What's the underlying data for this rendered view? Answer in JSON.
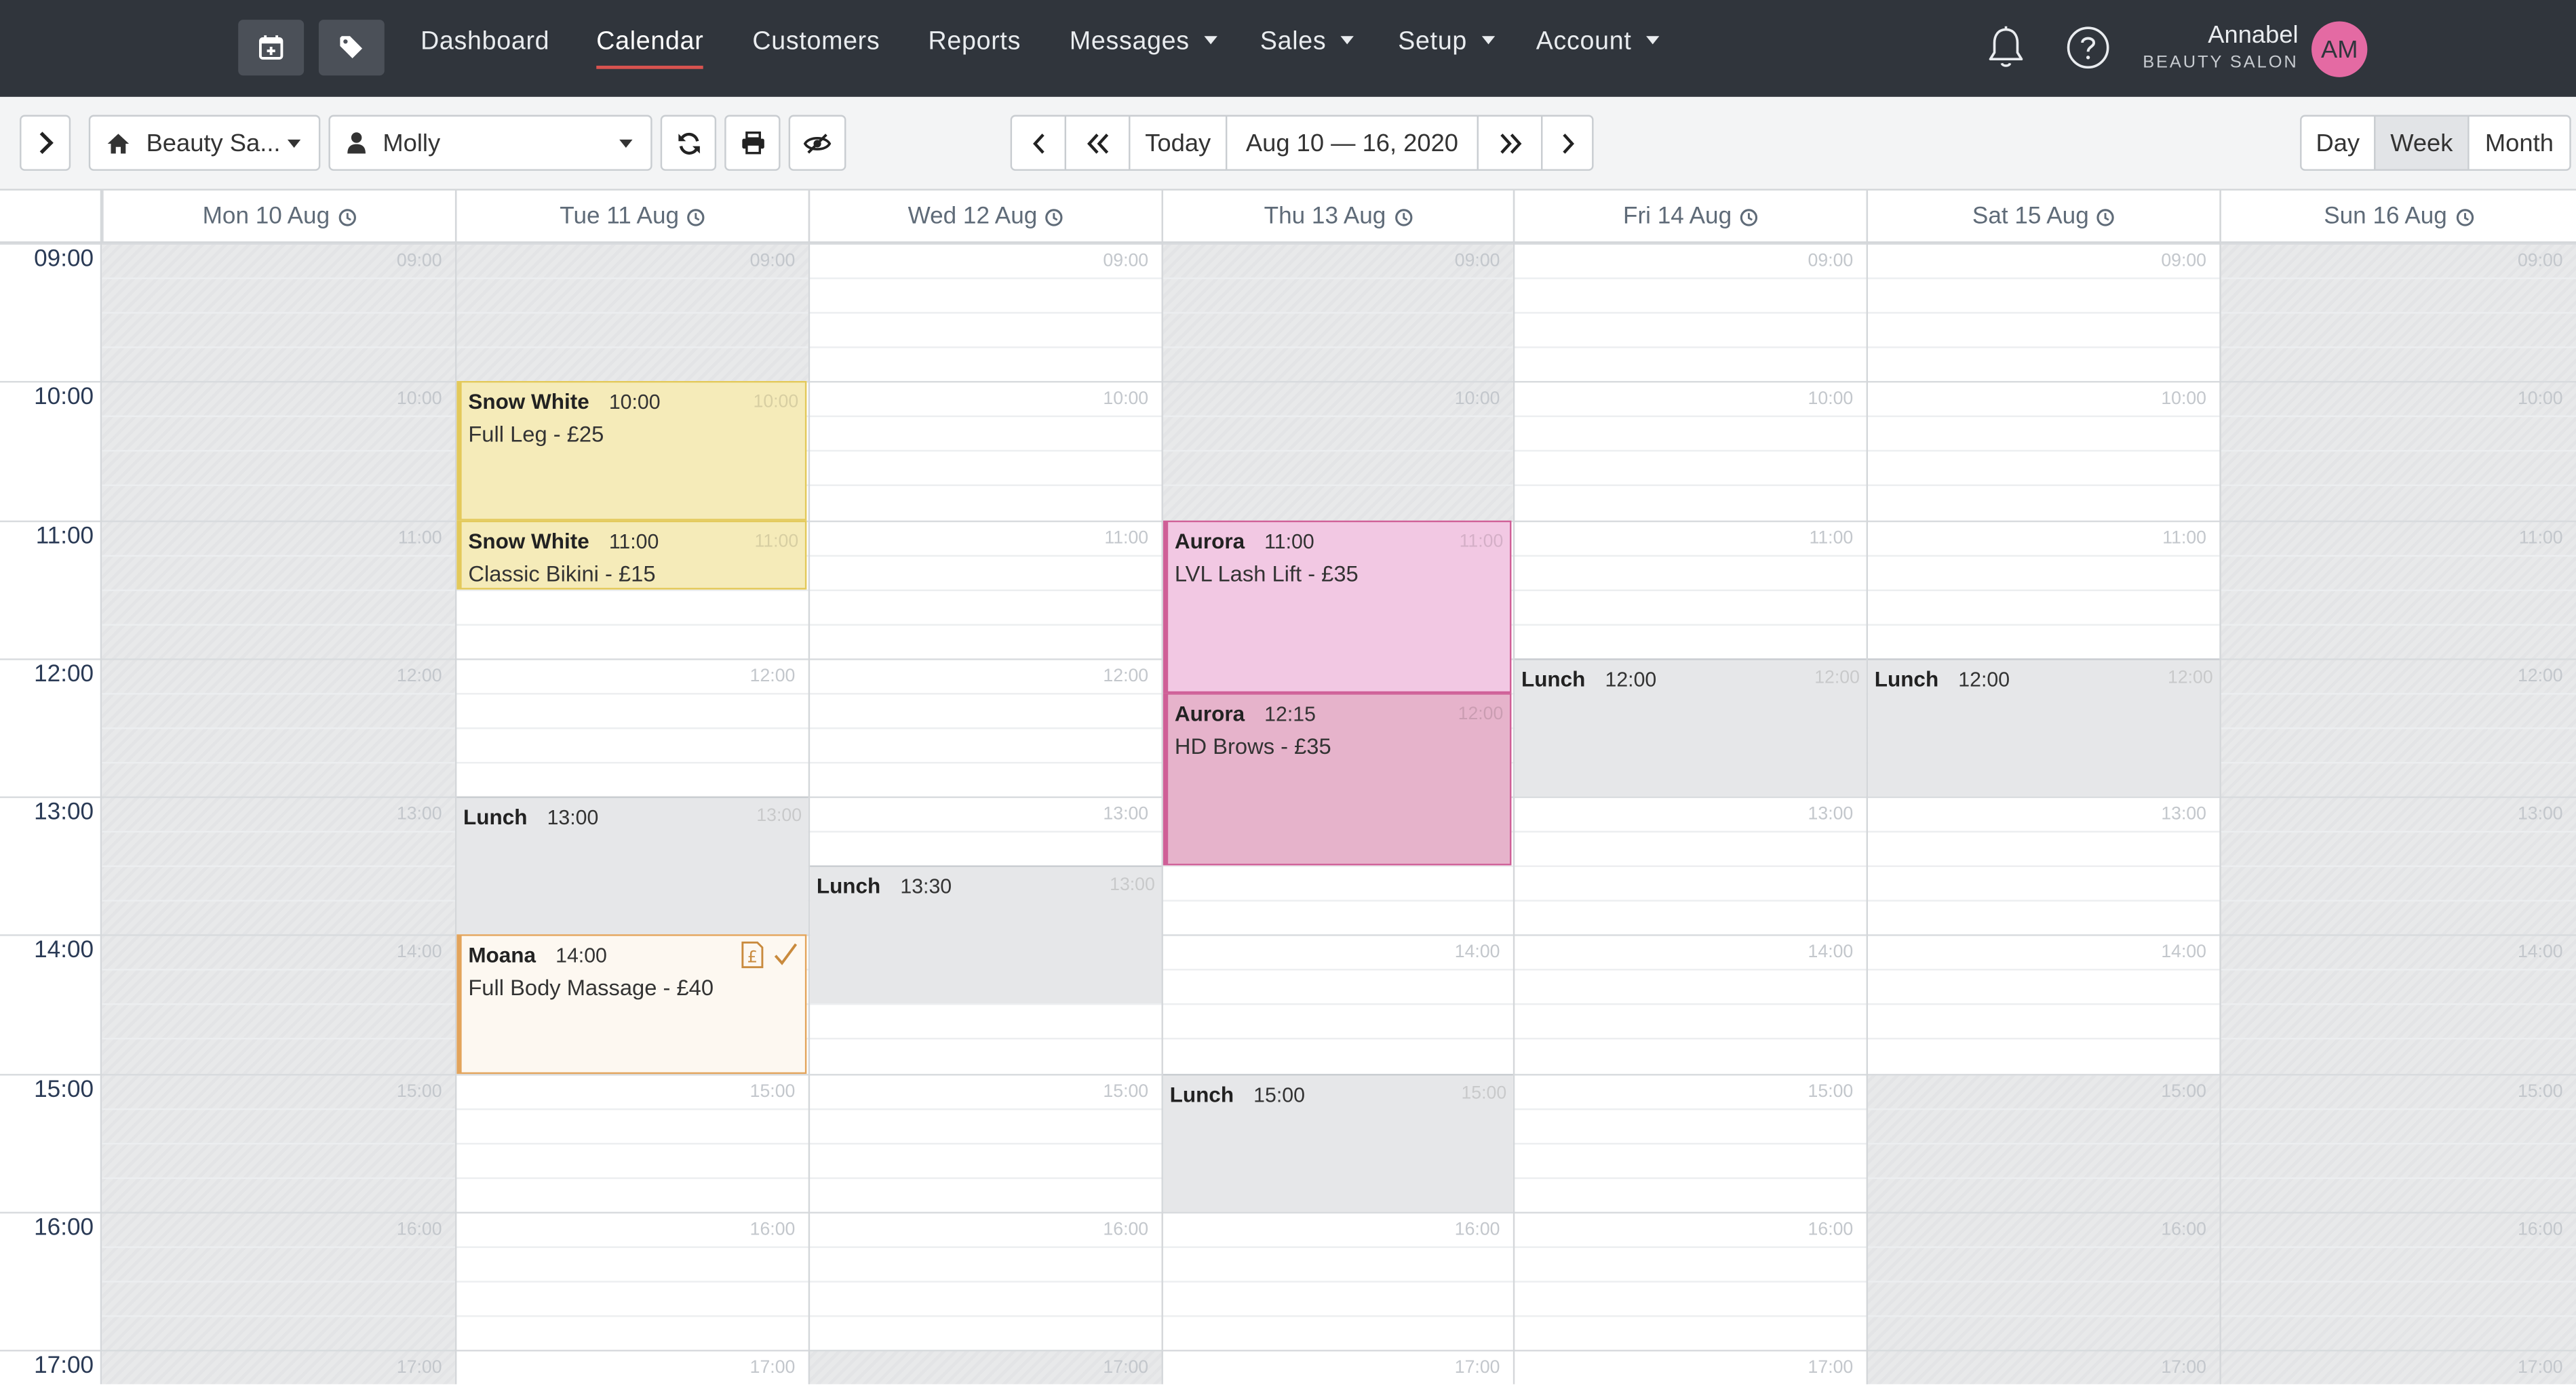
{
  "nav": {
    "items": [
      {
        "label": "Dashboard",
        "active": false,
        "has_menu": false
      },
      {
        "label": "Calendar",
        "active": true,
        "has_menu": false
      },
      {
        "label": "Customers",
        "active": false,
        "has_menu": false
      },
      {
        "label": "Reports",
        "active": false,
        "has_menu": false
      },
      {
        "label": "Messages",
        "active": false,
        "has_menu": true
      },
      {
        "label": "Sales",
        "active": false,
        "has_menu": true
      },
      {
        "label": "Setup",
        "active": false,
        "has_menu": true
      },
      {
        "label": "Account",
        "active": false,
        "has_menu": true
      }
    ],
    "user_name": "Annabel",
    "user_business": "BEAUTY SALON",
    "avatar_initials": "AM",
    "icons": [
      "calendar-plus-icon",
      "tag-icon",
      "bell-icon",
      "help-icon"
    ]
  },
  "toolbar": {
    "location_select": "Beauty Sa...",
    "staff_select": "Molly",
    "today_label": "Today",
    "date_range": "Aug 10 — 16, 2020",
    "views": [
      "Day",
      "Week",
      "Month"
    ],
    "active_view": "Week"
  },
  "calendar": {
    "days": [
      "Mon 10 Aug",
      "Tue 11 Aug",
      "Wed 12 Aug",
      "Thu 13 Aug",
      "Fri 14 Aug",
      "Sat 15 Aug",
      "Sun 16 Aug"
    ],
    "hours": [
      "09:00",
      "10:00",
      "11:00",
      "12:00",
      "13:00",
      "14:00",
      "15:00",
      "16:00",
      "17:00"
    ],
    "lunch_label": "Lunch",
    "lunches": [
      {
        "day": 1,
        "time": "13:00"
      },
      {
        "day": 2,
        "time": "13:30"
      },
      {
        "day": 3,
        "time": "15:00"
      },
      {
        "day": 4,
        "time": "12:00"
      },
      {
        "day": 5,
        "time": "12:00"
      }
    ],
    "appointments": [
      {
        "day": 1,
        "client": "Snow White",
        "time": "10:00",
        "service": "Full Leg - £25",
        "style": "yellow"
      },
      {
        "day": 1,
        "client": "Snow White",
        "time": "11:00",
        "service": "Classic Bikini - £15",
        "style": "yellow"
      },
      {
        "day": 1,
        "client": "Moana",
        "time": "14:00",
        "service": "Full Body Massage - £40",
        "style": "orange",
        "paid_icon": "pound-receipt-icon",
        "confirmed_icon": "check-icon"
      },
      {
        "day": 3,
        "client": "Aurora",
        "time": "11:00",
        "service": "LVL Lash Lift - £35",
        "style": "pink-light"
      },
      {
        "day": 3,
        "client": "Aurora",
        "time": "12:15",
        "service": "HD Brows - £35",
        "style": "pink"
      }
    ]
  },
  "colors": {
    "nav_bg": "#30353c",
    "accent": "#d9534f",
    "yellow_bg": "#f5ebb9",
    "yellow_border": "#e3c95a",
    "pink_light_bg": "#f2c8e3",
    "pink_bg": "#e6b3cb",
    "pink_border": "#cf5f97",
    "orange_bg": "#fdf8f1",
    "orange_border": "#e3a45b",
    "avatar_bg": "#e46aa3"
  }
}
